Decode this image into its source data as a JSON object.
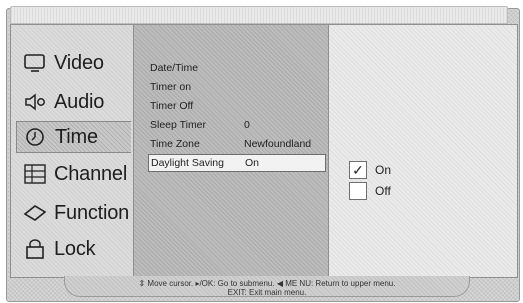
{
  "main_menu": {
    "items": [
      {
        "label": "Video",
        "icon": "monitor-icon"
      },
      {
        "label": "Audio",
        "icon": "speaker-icon"
      },
      {
        "label": "Time",
        "icon": "clock-icon"
      },
      {
        "label": "Channel",
        "icon": "channel-icon"
      },
      {
        "label": "Function",
        "icon": "diamond-icon"
      },
      {
        "label": "Lock",
        "icon": "lock-icon"
      }
    ],
    "selected": "Time"
  },
  "time_menu": {
    "items": [
      {
        "label": "Date/Time",
        "value": ""
      },
      {
        "label": "Timer on",
        "value": ""
      },
      {
        "label": "Timer Off",
        "value": ""
      },
      {
        "label": "Sleep Timer",
        "value": "0"
      },
      {
        "label": "Time Zone",
        "value": "Newfoundland"
      },
      {
        "label": "Daylight Saving",
        "value": "On"
      }
    ],
    "selected": "Daylight Saving"
  },
  "options": {
    "on": {
      "label": "On",
      "checked": true,
      "mark": "✓"
    },
    "off": {
      "label": "Off",
      "checked": false,
      "mark": ""
    }
  },
  "hint": {
    "line1": "⇕ Move cursor.  ▸/OK: Go to submenu.  ◀ ME NU: Return to upper menu.",
    "line2": "EXIT: Exit main menu."
  }
}
